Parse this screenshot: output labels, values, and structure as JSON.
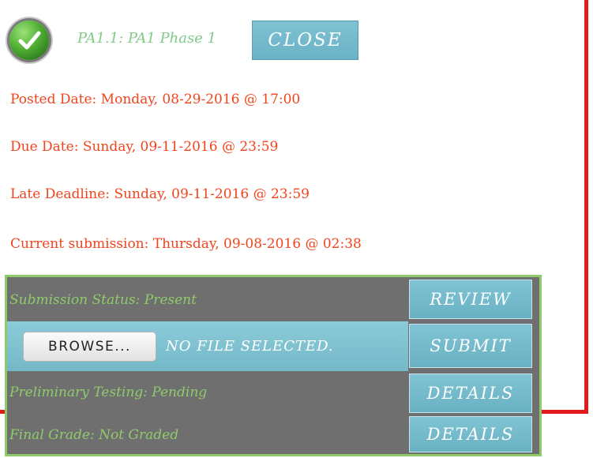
{
  "header": {
    "status_icon": "green-checkmark-icon",
    "title": "PA1.1: PA1 Phase 1",
    "close_label": "CLOSE"
  },
  "dates": {
    "posted": "Posted Date: Monday, 08-29-2016 @ 17:00",
    "due": "Due Date: Sunday, 09-11-2016 @ 23:59",
    "late": "Late Deadline: Sunday, 09-11-2016 @ 23:59",
    "current": "Current submission: Thursday, 09-08-2016 @ 02:38"
  },
  "panel": {
    "submission_status": "Submission Status: Present",
    "review_label": "REVIEW",
    "browse_label": "BROWSE...",
    "no_file_text": "NO FILE SELECTED.",
    "submit_label": "SUBMIT",
    "preliminary_testing": "Preliminary Testing: Pending",
    "details_label_1": "DETAILS",
    "final_grade": "Final Grade: Not Graded",
    "details_label_2": "DETAILS"
  },
  "colors": {
    "date_text": "#f2441c",
    "accent_green": "#8fcb6b",
    "button_blue": "#6ab2c5",
    "panel_gray": "#6f6f6f",
    "frame_red": "#e01b1b"
  }
}
